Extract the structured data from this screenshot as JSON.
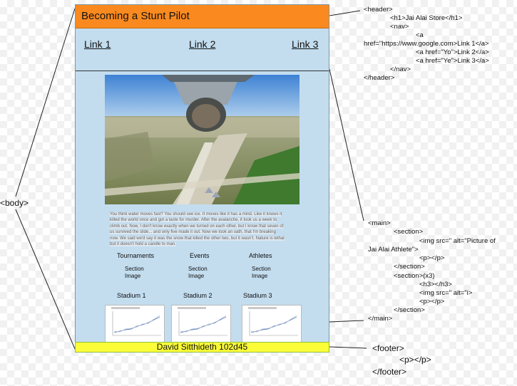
{
  "mockup": {
    "title": "Becoming a Stunt Pilot",
    "nav": [
      "Link 1",
      "Link 2",
      "Link 3"
    ],
    "hero_alt": "Picture of Jai Alai Athlete",
    "paragraph": "You think water moves fast? You should see ice. It moves like it has a mind. Like it knows it killed the world once and got a taste for murder. After the avalanche, it took us a week to climb out. Now, I don't know exactly when we turned on each other, but I know that seven of us survived the slide... and only five made it out. Now we took an oath, that I'm breaking now. We said we'd say it was the snow that killed the other two, but it wasn't. Nature is lethal but it doesn't hold a candle to man.",
    "sections": [
      {
        "heading": "Tournaments",
        "image_text": "Section Image"
      },
      {
        "heading": "Events",
        "image_text": "Section Image"
      },
      {
        "heading": "Athletes",
        "image_text": "Section Image"
      }
    ],
    "stadiums": [
      "Stadium 1",
      "Stadium 2",
      "Stadium 3"
    ],
    "footer": "David Sitthideth 102d45"
  },
  "annotations": {
    "body": "<body>",
    "header_code": [
      "<header>",
      "<h1>Jai Alai Store</h1>",
      "<nav>",
      "<a",
      "href=\"https://www.google.com>Link 1</a>",
      "<a href=\"Yo\">Link 2</a>",
      "<a href=\"Ye\">Link 3</a>",
      "</nav>",
      "</header>"
    ],
    "main_code": [
      "<main>",
      "<section>",
      "<img src=\" alt=\"Picture of",
      "Jai Alai Athlete\">",
      "<p></p>",
      "</section>",
      "<section>(x3)",
      "<h3></h3>",
      "<img src=\" alt=\"i>",
      "<p></p>",
      "</section>",
      "</main>"
    ],
    "footer_code": [
      "<footer>",
      "<p></p>",
      "</footer>"
    ]
  },
  "colors": {
    "header_bg": "#fa8a1f",
    "page_bg": "#c3ddef",
    "footer_bg": "#fbfd38"
  }
}
